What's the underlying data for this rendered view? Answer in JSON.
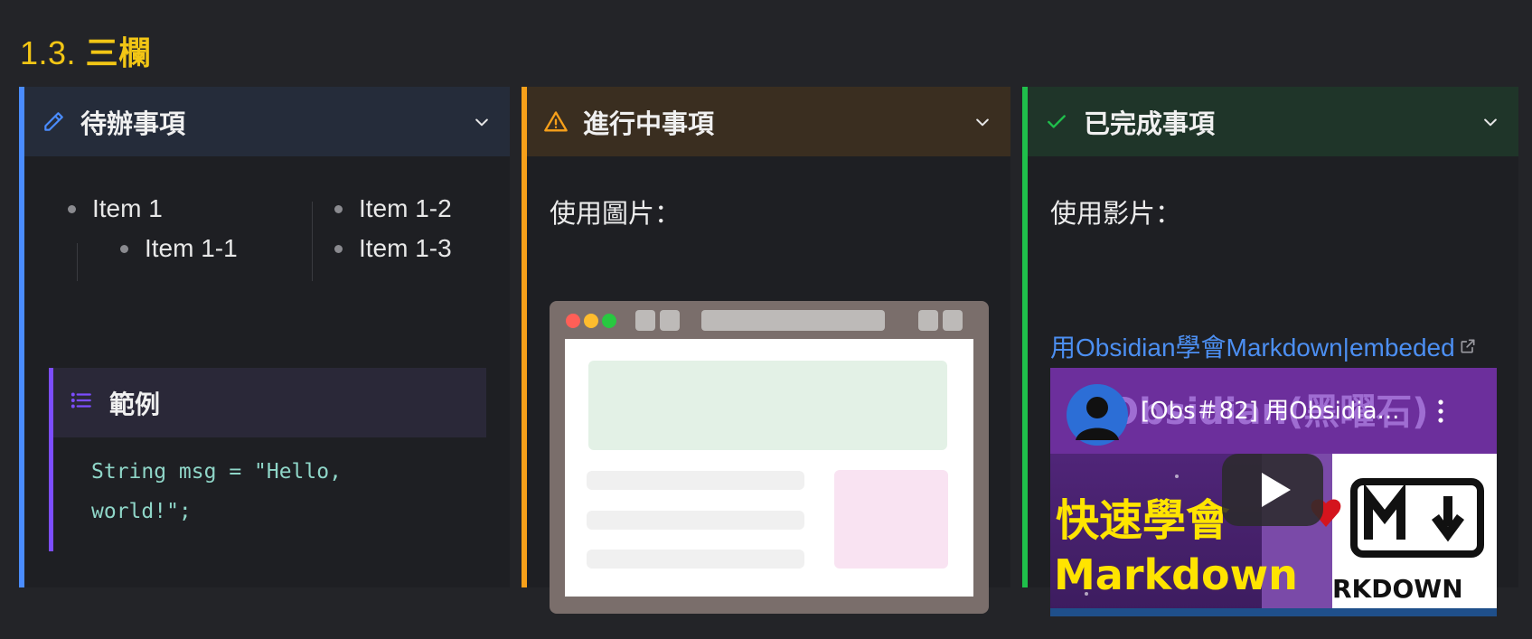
{
  "section": {
    "number": "1.3.",
    "title": "三欄"
  },
  "columns": {
    "todo": {
      "title": "待辦事項",
      "icon": "pencil-icon",
      "accent": "#4a8cff",
      "list_left": [
        "Item 1",
        "Item 1-1"
      ],
      "list_right": [
        "Item 1-2",
        "Item 1-3"
      ],
      "example": {
        "title": "範例",
        "icon": "list-icon",
        "code_line1": "String msg = \"Hello,",
        "code_line2": "world!\";"
      }
    },
    "doing": {
      "title": "進行中事項",
      "icon": "warning-icon",
      "accent": "#f7a01a",
      "image_label": "使用圖片："
    },
    "done": {
      "title": "已完成事項",
      "icon": "check-icon",
      "accent": "#1fbf4b",
      "video_label": "使用影片：",
      "video_link": "用Obsidian學會Markdown|embeded",
      "video_title": "[Obs＃82] 用Obsidia...",
      "thumb_big": "快速學會",
      "thumb_md": "Markdown",
      "thumb_rkdown": "RKDOWN",
      "thumb_top": "Obsidian(黑曜石)"
    }
  }
}
